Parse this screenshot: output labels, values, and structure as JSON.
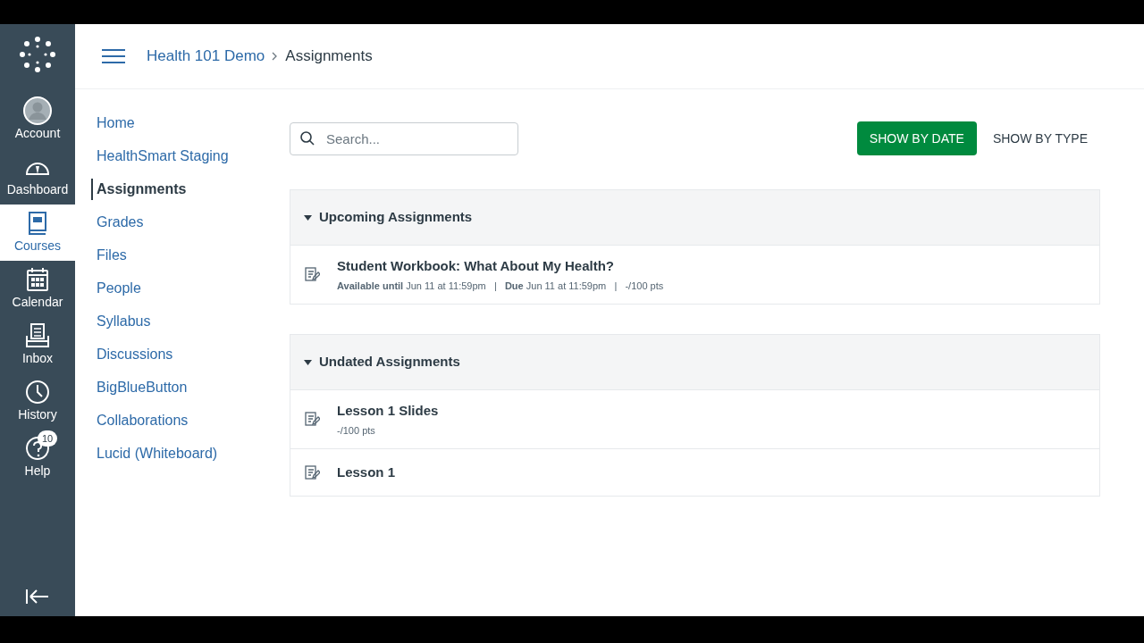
{
  "global_nav": [
    {
      "kind": "account",
      "label": "Account",
      "selected": false
    },
    {
      "kind": "dashboard",
      "label": "Dashboard",
      "selected": false
    },
    {
      "kind": "courses",
      "label": "Courses",
      "selected": true
    },
    {
      "kind": "calendar",
      "label": "Calendar",
      "selected": false
    },
    {
      "kind": "inbox",
      "label": "Inbox",
      "selected": false
    },
    {
      "kind": "history",
      "label": "History",
      "selected": false
    },
    {
      "kind": "help",
      "label": "Help",
      "selected": false,
      "badge": "10"
    }
  ],
  "breadcrumb": [
    "Health 101 Demo",
    "Assignments"
  ],
  "course_nav": [
    {
      "label": "Home",
      "selected": false
    },
    {
      "label": "HealthSmart Staging",
      "selected": false
    },
    {
      "label": "Assignments",
      "selected": true
    },
    {
      "label": "Grades",
      "selected": false
    },
    {
      "label": "Files",
      "selected": false
    },
    {
      "label": "People",
      "selected": false
    },
    {
      "label": "Syllabus",
      "selected": false
    },
    {
      "label": "Discussions",
      "selected": false
    },
    {
      "label": "BigBlueButton",
      "selected": false
    },
    {
      "label": "Collaborations",
      "selected": false
    },
    {
      "label": "Lucid (Whiteboard)",
      "selected": false
    }
  ],
  "search": {
    "placeholder": "Search..."
  },
  "view_buttons": [
    {
      "label": "SHOW BY DATE",
      "selected": true
    },
    {
      "label": "SHOW BY TYPE",
      "selected": false
    }
  ],
  "groups": [
    {
      "title": "Upcoming Assignments",
      "expanded": true,
      "items": [
        {
          "title": "Student Workbook: What About My Health?",
          "meta": "**Available until** Jun 11 at 11:59pm   |   **Due** Jun 11 at 11:59pm   |   -/100 pts"
        }
      ]
    },
    {
      "title": "Undated Assignments",
      "expanded": true,
      "items": [
        {
          "title": "Lesson 1 Slides",
          "meta": "-/100 pts"
        },
        {
          "title": "Lesson 1"
        }
      ]
    }
  ]
}
